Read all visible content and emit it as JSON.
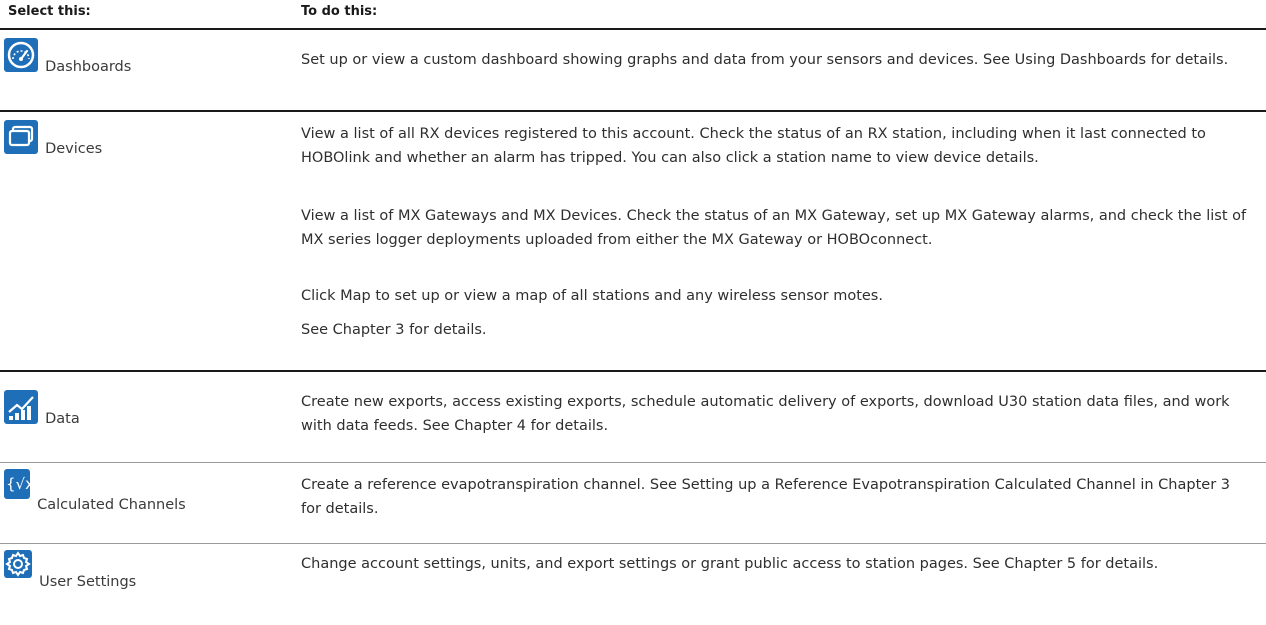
{
  "table": {
    "headers": {
      "select": "Select this:",
      "todo": "To do this:"
    },
    "rows": [
      {
        "label": "Dashboards",
        "icon": "dashboard-gauge-icon",
        "description": [
          "Set up or view a custom dashboard showing graphs and data from your sensors and devices. See Using Dashboards for details."
        ]
      },
      {
        "label": "Devices",
        "icon": "devices-stack-icon",
        "description": [
          "View a list of all RX devices registered to this account. Check the status of an RX station, including when it last connected to HOBOlink and whether an alarm has tripped. You can also click a station name to view device details.",
          "View a list of MX Gateways and MX Devices. Check the status of an MX Gateway, set up MX Gateway alarms, and check the list of MX series logger deployments uploaded from either the MX Gateway or HOBOconnect.",
          "Click Map to set up or view a map of all stations and any wireless sensor motes.",
          "See Chapter 3 for details."
        ]
      },
      {
        "label": "Data",
        "icon": "data-chart-icon",
        "description": [
          "Create new exports, access existing exports, schedule automatic delivery of exports, download U30 station data files, and work with data feeds. See Chapter 4 for details."
        ]
      },
      {
        "label": "Calculated Channels",
        "icon": "calculated-channel-sqrt-icon",
        "description": [
          "Create a reference evapotranspiration channel. See Setting up a Reference Evapotranspiration Calculated Channel in Chapter 3 for details."
        ]
      },
      {
        "label": "User Settings",
        "icon": "settings-gear-icon",
        "description": [
          "Change account settings, units, and export settings or grant public access to station pages. See Chapter 5 for details."
        ]
      }
    ]
  },
  "colors": {
    "icon_bg": "#1f6fb8",
    "rule_dark": "#1a1a1a",
    "rule_light": "#9a9a9a"
  }
}
